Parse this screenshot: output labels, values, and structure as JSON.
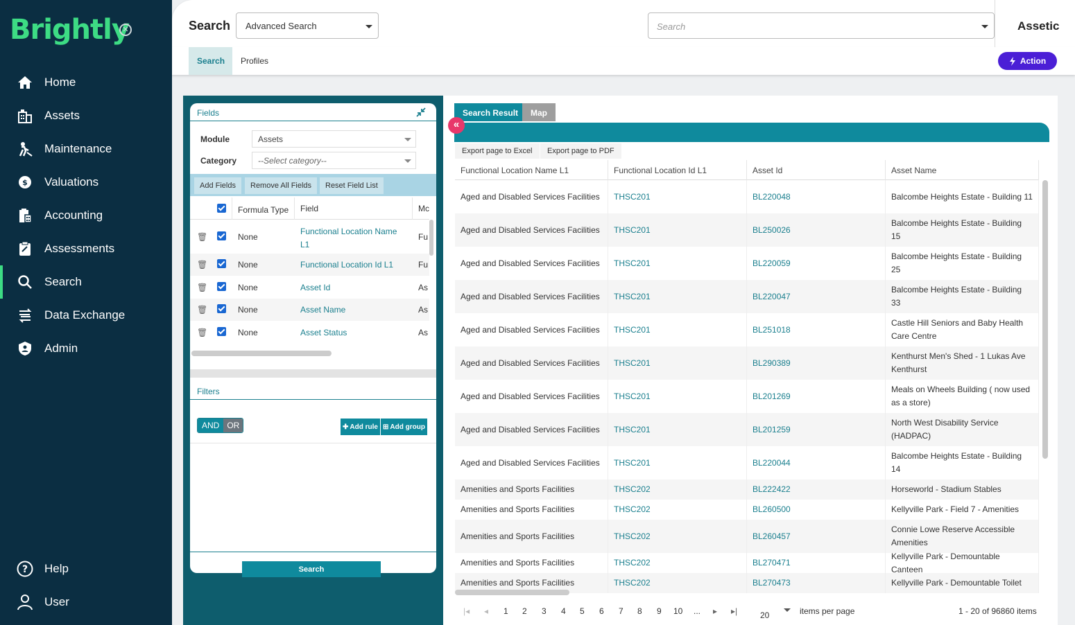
{
  "sidebar": {
    "logo": "Brightly",
    "items": [
      {
        "label": "Home",
        "icon": "home-icon"
      },
      {
        "label": "Assets",
        "icon": "building-icon"
      },
      {
        "label": "Maintenance",
        "icon": "worker-icon"
      },
      {
        "label": "Valuations",
        "icon": "valuation-icon"
      },
      {
        "label": "Accounting",
        "icon": "accounting-icon"
      },
      {
        "label": "Assessments",
        "icon": "assessment-icon"
      },
      {
        "label": "Search",
        "icon": "search-icon"
      },
      {
        "label": "Data Exchange",
        "icon": "data-exchange-icon"
      },
      {
        "label": "Admin",
        "icon": "shield-icon"
      }
    ],
    "bottom": [
      {
        "label": "Help",
        "icon": "help-icon"
      },
      {
        "label": "User",
        "icon": "user-icon"
      }
    ],
    "active": "Search"
  },
  "header": {
    "title": "Search",
    "search_type": "Advanced Search",
    "search_placeholder": "Search",
    "brand": "Assetic"
  },
  "subtabs": {
    "search": "Search",
    "profiles": "Profiles",
    "action": "Action"
  },
  "fields_panel": {
    "title": "Fields",
    "module_label": "Module",
    "module_value": "Assets",
    "category_label": "Category",
    "category_value": "--Select category--",
    "buttons": {
      "add": "Add Fields",
      "remove_all": "Remove All Fields",
      "reset": "Reset Field List"
    },
    "columns": {
      "formula": "Formula Type",
      "field": "Field",
      "module": "Mc"
    },
    "rows": [
      {
        "formula": "None",
        "field": "Functional Location Name L1",
        "module": "Fu"
      },
      {
        "formula": "None",
        "field": "Functional Location Id L1",
        "module": "Fu"
      },
      {
        "formula": "None",
        "field": "Asset Id",
        "module": "As"
      },
      {
        "formula": "None",
        "field": "Asset Name",
        "module": "As"
      },
      {
        "formula": "None",
        "field": "Asset Status",
        "module": "As"
      }
    ]
  },
  "filters_panel": {
    "title": "Filters",
    "and": "AND",
    "or": "OR",
    "add_rule": "Add rule",
    "add_group": "Add group",
    "search_button": "Search"
  },
  "results": {
    "tabs": {
      "result": "Search Result",
      "map": "Map"
    },
    "export_excel": "Export page to Excel",
    "export_pdf": "Export page to PDF",
    "columns": [
      "Functional Location Name L1",
      "Functional Location Id L1",
      "Asset Id",
      "Asset Name"
    ],
    "rows": [
      [
        "Aged and Disabled Services Facilities",
        "THSC201",
        "BL220048",
        "Balcombe Heights Estate - Building 11"
      ],
      [
        "Aged and Disabled Services Facilities",
        "THSC201",
        "BL250026",
        "Balcombe Heights Estate - Building 15"
      ],
      [
        "Aged and Disabled Services Facilities",
        "THSC201",
        "BL220059",
        "Balcombe Heights Estate - Building 25"
      ],
      [
        "Aged and Disabled Services Facilities",
        "THSC201",
        "BL220047",
        "Balcombe Heights Estate - Building 33"
      ],
      [
        "Aged and Disabled Services Facilities",
        "THSC201",
        "BL251018",
        "Castle Hill Seniors and Baby Health Care Centre"
      ],
      [
        "Aged and Disabled Services Facilities",
        "THSC201",
        "BL290389",
        "Kenthurst Men's Shed - 1 Lukas Ave Kenthurst"
      ],
      [
        "Aged and Disabled Services Facilities",
        "THSC201",
        "BL201269",
        "Meals on Wheels Building ( now used as a store)"
      ],
      [
        "Aged and Disabled Services Facilities",
        "THSC201",
        "BL201259",
        "North West Disability Service (HADPAC)"
      ],
      [
        "Aged and Disabled Services Facilities",
        "THSC201",
        "BL220044",
        "Balcombe Heights Estate - Building 14"
      ],
      [
        "Amenities and Sports Facilities",
        "THSC202",
        "BL222422",
        "Horseworld - Stadium Stables"
      ],
      [
        "Amenities and Sports Facilities",
        "THSC202",
        "BL260500",
        "Kellyville Park - Field 7 - Amenities"
      ],
      [
        "Amenities and Sports Facilities",
        "THSC202",
        "BL260457",
        "Connie Lowe Reserve Accessible Amenities"
      ],
      [
        "Amenities and Sports Facilities",
        "THSC202",
        "BL270471",
        "Kellyville Park - Demountable Canteen"
      ],
      [
        "Amenities and Sports Facilities",
        "THSC202",
        "BL270473",
        "Kellyville Park - Demountable Toilet"
      ]
    ],
    "pager": {
      "pages": [
        "1",
        "2",
        "3",
        "4",
        "5",
        "6",
        "7",
        "8",
        "9",
        "10",
        "..."
      ],
      "page_size": "20",
      "per_page_label": "items per page",
      "summary": "1 - 20 of 96860 items"
    }
  },
  "colors": {
    "sidebar": "#0b2e42",
    "accent": "#3ddc84",
    "teal": "#0f8a9d",
    "action": "#4b1fd6",
    "collapse": "#e8386b"
  }
}
